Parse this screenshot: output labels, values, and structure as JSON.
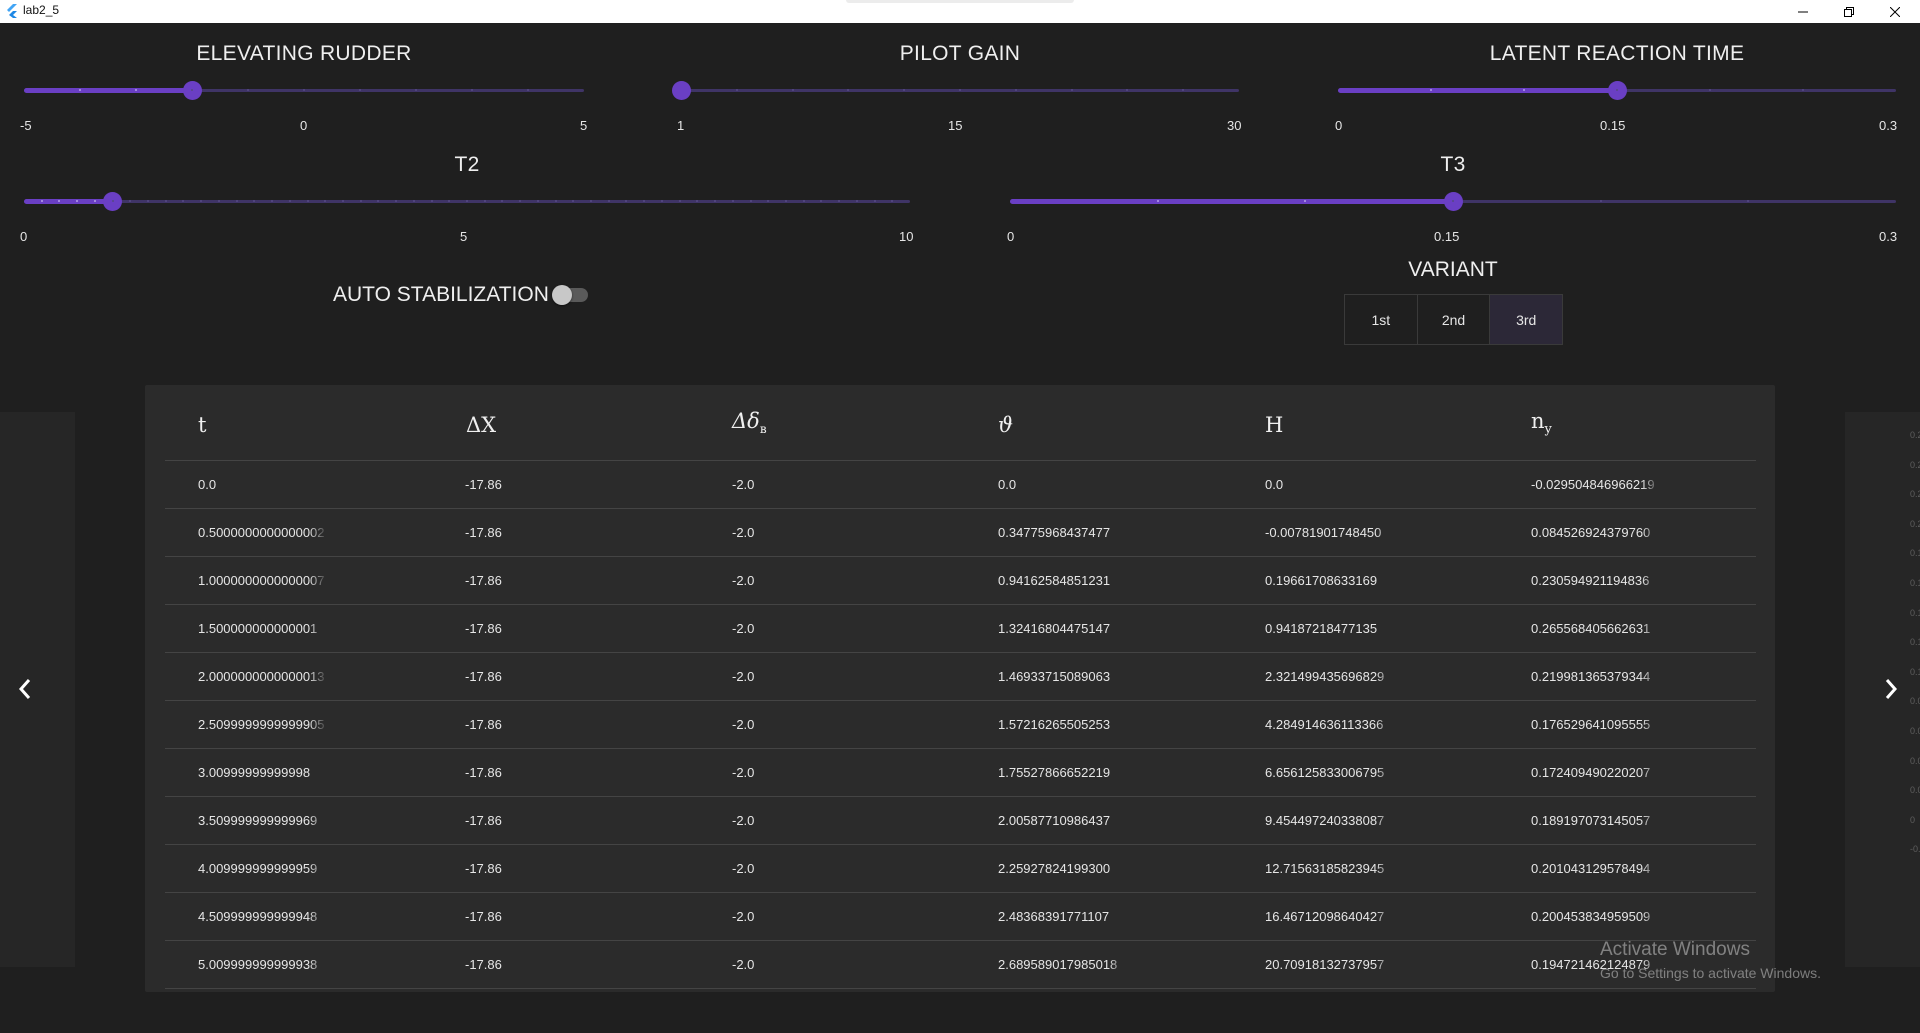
{
  "window": {
    "title": "lab2_5",
    "icon": "flutter-icon",
    "controls": [
      "minimize-icon",
      "restore-icon",
      "close-icon"
    ]
  },
  "theme": {
    "accent": "#6a3fc4",
    "track": "#3f3466",
    "background": "#1f1f1f",
    "card": "#2b2b2b"
  },
  "sliders": {
    "elevating_rudder": {
      "title": "ELEVATING RUDDER",
      "min_label": "-5",
      "mid_label": "0",
      "max_label": "5",
      "min": -5,
      "max": 5,
      "value": -2
    },
    "pilot_gain": {
      "title": "PILOT GAIN",
      "min_label": "1",
      "mid_label": "15",
      "max_label": "30",
      "min": 1,
      "max": 30,
      "value": 1
    },
    "latent_reaction_time": {
      "title": "LATENT REACTION TIME",
      "min_label": "0",
      "mid_label": "0.15",
      "max_label": "0.3",
      "min": 0,
      "max": 0.3,
      "value": 0.15
    },
    "t2": {
      "title": "T2",
      "min_label": "0",
      "mid_label": "5",
      "max_label": "10",
      "min": 0,
      "max": 10,
      "value": 1
    },
    "t3": {
      "title": "T3",
      "min_label": "0",
      "mid_label": "0.15",
      "max_label": "0.3",
      "min": 0,
      "max": 0.3,
      "value": 0.15
    }
  },
  "auto_stabilization": {
    "label": "AUTO STABILIZATION",
    "enabled": false
  },
  "variant": {
    "title": "VARIANT",
    "options": [
      "1st",
      "2nd",
      "3rd"
    ],
    "selected": "3rd"
  },
  "table": {
    "columns": [
      {
        "label": "t"
      },
      {
        "label": "ΔX"
      },
      {
        "label": "Δδ",
        "sub": "в"
      },
      {
        "label": "ϑ"
      },
      {
        "label": "H"
      },
      {
        "label": "n",
        "sub": "y"
      }
    ],
    "rows": [
      [
        "0.0",
        "-17.86",
        "-2.0",
        "0.0",
        "0.0",
        "-0.029504846966219"
      ],
      [
        "0.5000000000000002",
        "-17.86",
        "-2.0",
        "0.34775968437477",
        "-0.00781901748450",
        "0.084526924379760"
      ],
      [
        "1.0000000000000007",
        "-17.86",
        "-2.0",
        "0.94162584851231",
        "0.19661708633169",
        "0.230594921194836"
      ],
      [
        "1.500000000000001",
        "-17.86",
        "-2.0",
        "1.32416804475147",
        "0.94187218477135",
        "0.265568405662631"
      ],
      [
        "2.0000000000000013",
        "-17.86",
        "-2.0",
        "1.46933715089063",
        "2.321499435696829",
        "0.219981365379344"
      ],
      [
        "2.5099999999999905",
        "-17.86",
        "-2.0",
        "1.57216265505253",
        "4.284914636113366",
        "0.176529641095555"
      ],
      [
        "3.00999999999998",
        "-17.86",
        "-2.0",
        "1.75527866652219",
        "6.656125833006795",
        "0.172409490220207"
      ],
      [
        "3.509999999999969",
        "-17.86",
        "-2.0",
        "2.00587710986437",
        "9.454497240338087",
        "0.189197073145057"
      ],
      [
        "4.009999999999959",
        "-17.86",
        "-2.0",
        "2.25927824199300",
        "12.71563185823945",
        "0.201043129578494"
      ],
      [
        "4.509999999999948",
        "-17.86",
        "-2.0",
        "2.48368391771107",
        "16.46712098640427",
        "0.200453834959509"
      ],
      [
        "5.009999999999938",
        "-17.86",
        "-2.0",
        "2.689589017985018",
        "20.70918132737957",
        "0.194721462124879"
      ]
    ]
  },
  "navigation": {
    "prev_icon": "chevron-left-icon",
    "next_icon": "chevron-right-icon"
  },
  "watermark": {
    "title": "Activate Windows",
    "subtitle": "Go to Settings to activate Windows."
  }
}
